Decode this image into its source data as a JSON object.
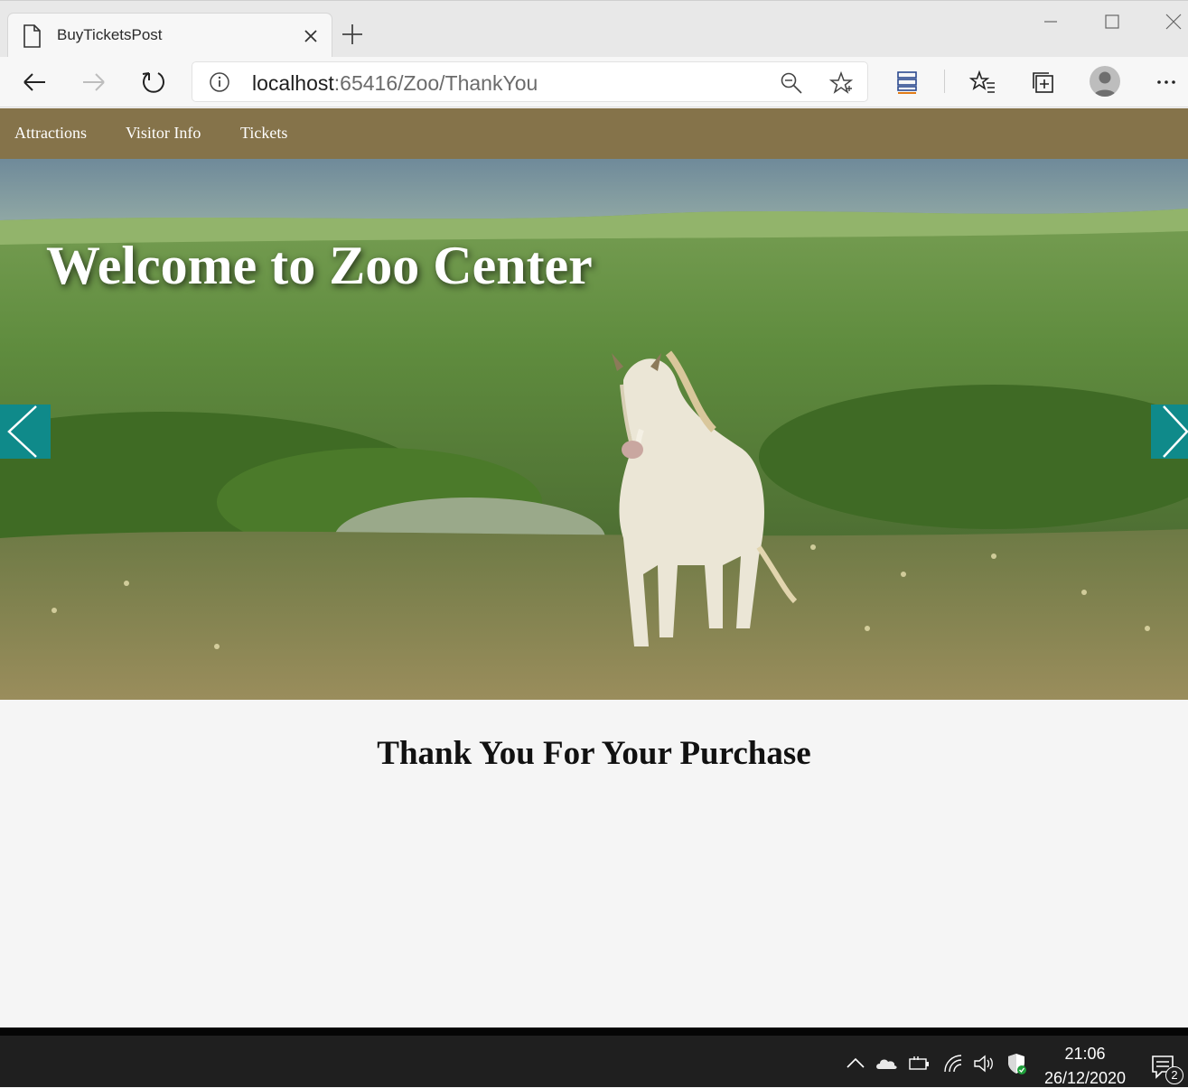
{
  "browser": {
    "tab_title": "BuyTicketsPost",
    "url_host": "localhost",
    "url_path": ":65416/Zoo/ThankYou"
  },
  "site": {
    "nav": [
      {
        "label": "Attractions"
      },
      {
        "label": "Visitor Info"
      },
      {
        "label": "Tickets"
      }
    ],
    "nav_color": "#85734a",
    "hero_title": "Welcome to Zoo Center",
    "carousel_arrow_color": "#0f8a8a",
    "thanks_heading": "Thank You For Your Purchase"
  },
  "taskbar": {
    "time": "21:06",
    "date": "26/12/2020",
    "notification_count": "2"
  }
}
